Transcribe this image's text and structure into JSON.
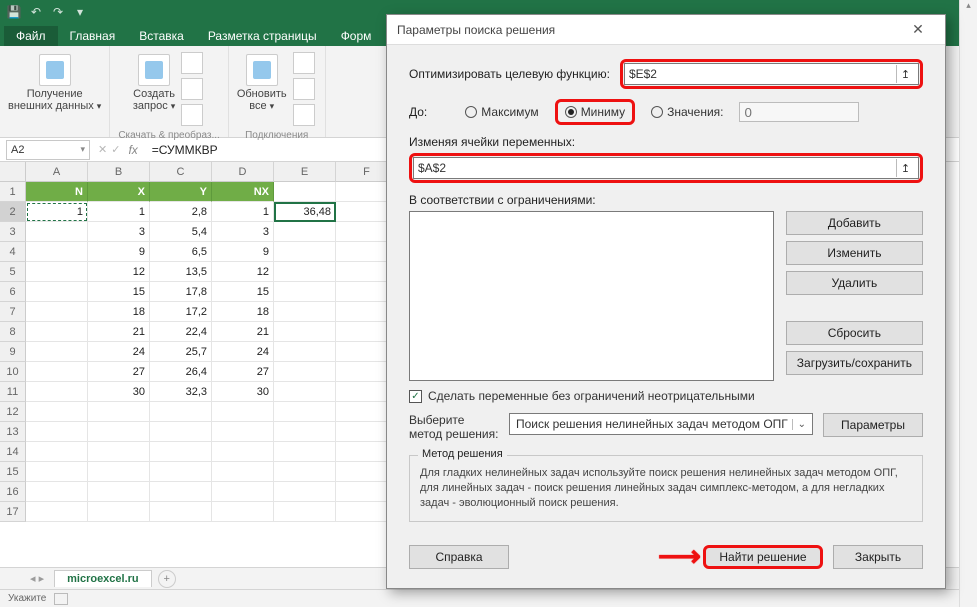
{
  "titlebar": {
    "qat_icons": [
      "save-icon",
      "undo-icon",
      "redo-icon",
      "touch-icon"
    ]
  },
  "ribbon": {
    "tabs": [
      "Файл",
      "Главная",
      "Вставка",
      "Разметка страницы",
      "Форм"
    ],
    "group1": {
      "big_label_l1": "Получение",
      "big_label_l2": "внешних данных",
      "label": ""
    },
    "group2": {
      "big_label_l1": "Создать",
      "big_label_l2": "запрос",
      "label": "Скачать & преобраз..."
    },
    "group3": {
      "big_label_l1": "Обновить",
      "big_label_l2": "все",
      "label": "Подключения"
    }
  },
  "formula_bar": {
    "name_box": "A2",
    "formula": "=СУММКВР"
  },
  "columns": [
    "A",
    "B",
    "C",
    "D",
    "E",
    "F"
  ],
  "row_numbers": [
    "1",
    "2",
    "3",
    "4",
    "5",
    "6",
    "7",
    "8",
    "9",
    "10",
    "11",
    "12",
    "13",
    "14",
    "15",
    "16",
    "17"
  ],
  "table": {
    "headers": [
      "N",
      "X",
      "Y",
      "NX",
      ""
    ],
    "rows": [
      [
        "1",
        "1",
        "2,8",
        "1",
        "36,48"
      ],
      [
        "",
        "3",
        "5,4",
        "3",
        ""
      ],
      [
        "",
        "9",
        "6,5",
        "9",
        ""
      ],
      [
        "",
        "12",
        "13,5",
        "12",
        ""
      ],
      [
        "",
        "15",
        "17,8",
        "15",
        ""
      ],
      [
        "",
        "18",
        "17,2",
        "18",
        ""
      ],
      [
        "",
        "21",
        "22,4",
        "21",
        ""
      ],
      [
        "",
        "24",
        "25,7",
        "24",
        ""
      ],
      [
        "",
        "27",
        "26,4",
        "27",
        ""
      ],
      [
        "",
        "30",
        "32,3",
        "30",
        ""
      ]
    ]
  },
  "sheet_tabs": {
    "active": "microexcel.ru"
  },
  "statusbar": {
    "mode": "Укажите"
  },
  "dialog": {
    "title": "Параметры поиска решения",
    "close": "✕",
    "objective_label": "Оптимизировать целевую функцию:",
    "objective_value": "$E$2",
    "to_label": "До:",
    "opt_max": "Максимум",
    "opt_min": "Миниму",
    "opt_val": "Значения:",
    "val_placeholder": "0",
    "changing_label": "Изменяя ячейки переменных:",
    "changing_value": "$A$2",
    "constraints_label": "В соответствии с ограничениями:",
    "btn_add": "Добавить",
    "btn_change": "Изменить",
    "btn_delete": "Удалить",
    "btn_reset": "Сбросить",
    "btn_loadsave": "Загрузить/сохранить",
    "chk_nonneg": "Сделать переменные без ограничений неотрицательными",
    "method_label_l1": "Выберите",
    "method_label_l2": "метод решения:",
    "method_value": "Поиск решения нелинейных задач методом ОПГ",
    "btn_params": "Параметры",
    "group_title": "Метод решения",
    "group_text": "Для гладких нелинейных задач используйте поиск решения нелинейных задач методом ОПГ, для линейных задач - поиск решения линейных задач симплекс-методом, а для негладких задач - эволюционный поиск решения.",
    "btn_help": "Справка",
    "btn_solve": "Найти решение",
    "btn_close": "Закрыть"
  }
}
